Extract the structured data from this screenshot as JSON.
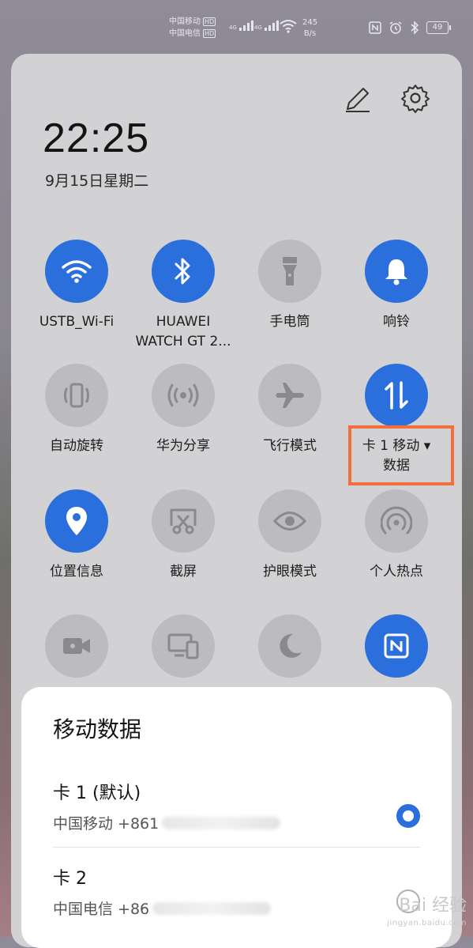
{
  "status_bar": {
    "carrier1": "中国移动",
    "carrier2": "中国电信",
    "hd_badge": "HD",
    "network_type": "4G",
    "speed_value": "245",
    "speed_unit": "B/s",
    "battery": "49",
    "icons": [
      "nfc-icon",
      "alarm-icon",
      "bluetooth-icon"
    ]
  },
  "panel": {
    "time": "22:25",
    "date": "9月15日星期二",
    "icons": {
      "edit": "pencil-icon",
      "settings": "gear-icon"
    },
    "tiles": [
      {
        "label": "USTB_Wi-Fi",
        "icon": "wifi-icon",
        "state": "on"
      },
      {
        "label": "HUAWEI\nWATCH GT 2...",
        "icon": "bluetooth-icon",
        "state": "on"
      },
      {
        "label": "手电筒",
        "icon": "flashlight-icon",
        "state": "off"
      },
      {
        "label": "响铃",
        "icon": "bell-icon",
        "state": "on"
      },
      {
        "label": "自动旋转",
        "icon": "auto-rotate-icon",
        "state": "off"
      },
      {
        "label": "华为分享",
        "icon": "share-icon",
        "state": "off"
      },
      {
        "label": "飞行模式",
        "icon": "airplane-icon",
        "state": "off"
      },
      {
        "label": "卡 1 移动 ▾\n数据",
        "icon": "mobile-data-icon",
        "state": "on"
      },
      {
        "label": "位置信息",
        "icon": "location-icon",
        "state": "on"
      },
      {
        "label": "截屏",
        "icon": "screenshot-icon",
        "state": "off"
      },
      {
        "label": "护眼模式",
        "icon": "eye-icon",
        "state": "off"
      },
      {
        "label": "个人热点",
        "icon": "hotspot-icon",
        "state": "off"
      },
      {
        "label": "",
        "icon": "screen-record-icon",
        "state": "off"
      },
      {
        "label": "",
        "icon": "multi-screen-icon",
        "state": "off"
      },
      {
        "label": "",
        "icon": "dark-mode-icon",
        "state": "off"
      },
      {
        "label": "",
        "icon": "nfc-icon",
        "state": "on"
      }
    ]
  },
  "sheet": {
    "title": "移动数据",
    "options": [
      {
        "name": "卡 1 (默认)",
        "number": "中国移动 +861",
        "selected": true
      },
      {
        "name": "卡 2",
        "number": "中国电信 +86",
        "selected": false
      }
    ]
  },
  "watermark": {
    "text": "Bai 经验",
    "sub": "jingyan.baidu.com"
  },
  "colors": {
    "accent": "#2a6fdc",
    "highlight": "#f26e3a",
    "tile_off": "#bcbbbf"
  }
}
